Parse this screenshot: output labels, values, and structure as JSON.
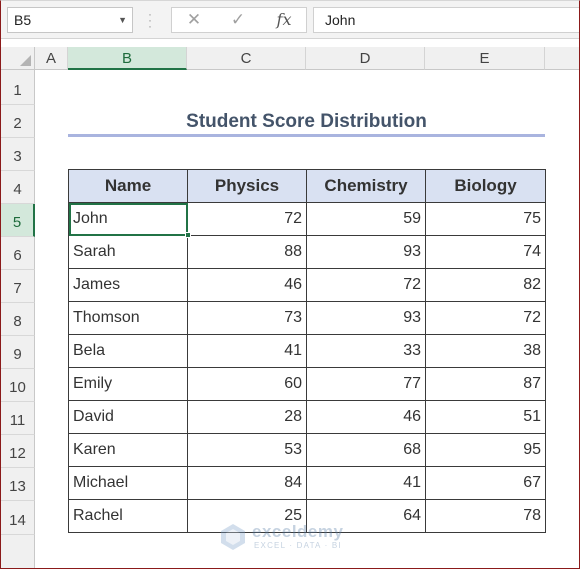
{
  "formula_bar": {
    "name_box": "B5",
    "cancel_icon": "x-icon",
    "enter_icon": "check-icon",
    "fx_label": "fx",
    "formula_value": "John"
  },
  "columns": [
    "A",
    "B",
    "C",
    "D",
    "E"
  ],
  "selected_column": "B",
  "rows": [
    "1",
    "2",
    "3",
    "4",
    "5",
    "6",
    "7",
    "8",
    "9",
    "10",
    "11",
    "12",
    "13",
    "14"
  ],
  "selected_row": "5",
  "sheet": {
    "title": "Student Score Distribution",
    "headers": [
      "Name",
      "Physics",
      "Chemistry",
      "Biology"
    ],
    "records": [
      {
        "name": "John",
        "physics": "72",
        "chemistry": "59",
        "biology": "75"
      },
      {
        "name": "Sarah",
        "physics": "88",
        "chemistry": "93",
        "biology": "74"
      },
      {
        "name": "James",
        "physics": "46",
        "chemistry": "72",
        "biology": "82"
      },
      {
        "name": "Thomson",
        "physics": "73",
        "chemistry": "93",
        "biology": "72"
      },
      {
        "name": "Bela",
        "physics": "41",
        "chemistry": "33",
        "biology": "38"
      },
      {
        "name": "Emily",
        "physics": "60",
        "chemistry": "77",
        "biology": "87"
      },
      {
        "name": "David",
        "physics": "28",
        "chemistry": "46",
        "biology": "51"
      },
      {
        "name": "Karen",
        "physics": "53",
        "chemistry": "68",
        "biology": "95"
      },
      {
        "name": "Michael",
        "physics": "84",
        "chemistry": "41",
        "biology": "67"
      },
      {
        "name": "Rachel",
        "physics": "25",
        "chemistry": "64",
        "biology": "78"
      }
    ]
  },
  "watermark": {
    "brand": "exceldemy",
    "tagline": "EXCEL · DATA · BI"
  },
  "colors": {
    "accent": "#217346",
    "header_fill": "#d9e1f2",
    "title": "#44546a"
  }
}
